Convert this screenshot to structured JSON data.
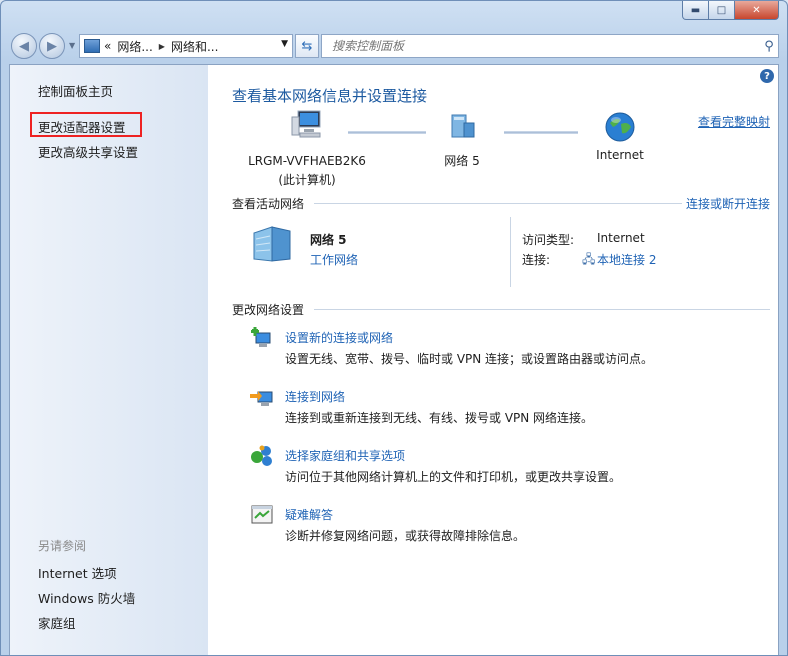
{
  "window": {
    "caption_buttons": {
      "minimize": "▬",
      "maximize": "□",
      "close": "✕"
    }
  },
  "nav": {
    "back_icon": "back-arrow-icon",
    "forward_icon": "forward-arrow-icon",
    "breadcrumb": [
      "«",
      "网络...",
      "网络和..."
    ],
    "search_placeholder": "搜索控制面板"
  },
  "sidebar": {
    "home": "控制面板主页",
    "adapter": "更改适配器设置",
    "advanced": "更改高级共享设置",
    "see_also_heading": "另请参阅",
    "see_also": [
      "Internet 选项",
      "Windows 防火墙",
      "家庭组"
    ]
  },
  "main": {
    "title": "查看基本网络信息并设置连接",
    "full_map_link": "查看完整映射",
    "map_nodes": [
      {
        "label": "LRGM-VVFHAEB2K6",
        "sub": "(此计算机)"
      },
      {
        "label": "网络  5",
        "sub": ""
      },
      {
        "label": "Internet",
        "sub": ""
      }
    ],
    "active": {
      "heading": "查看活动网络",
      "connect_link": "连接或断开连接",
      "network_name": "网络  5",
      "network_type": "工作网络",
      "access_type_label": "访问类型:",
      "access_type_value": "Internet",
      "connection_label": "连接:",
      "connection_value": "本地连接 2"
    },
    "change": {
      "heading": "更改网络设置",
      "tasks": [
        {
          "title": "设置新的连接或网络",
          "desc": "设置无线、宽带、拨号、临时或 VPN 连接；或设置路由器或访问点。"
        },
        {
          "title": "连接到网络",
          "desc": "连接到或重新连接到无线、有线、拨号或 VPN 网络连接。"
        },
        {
          "title": "选择家庭组和共享选项",
          "desc": "访问位于其他网络计算机上的文件和打印机，或更改共享设置。"
        },
        {
          "title": "疑难解答",
          "desc": "诊断并修复网络问题，或获得故障排除信息。"
        }
      ]
    }
  }
}
